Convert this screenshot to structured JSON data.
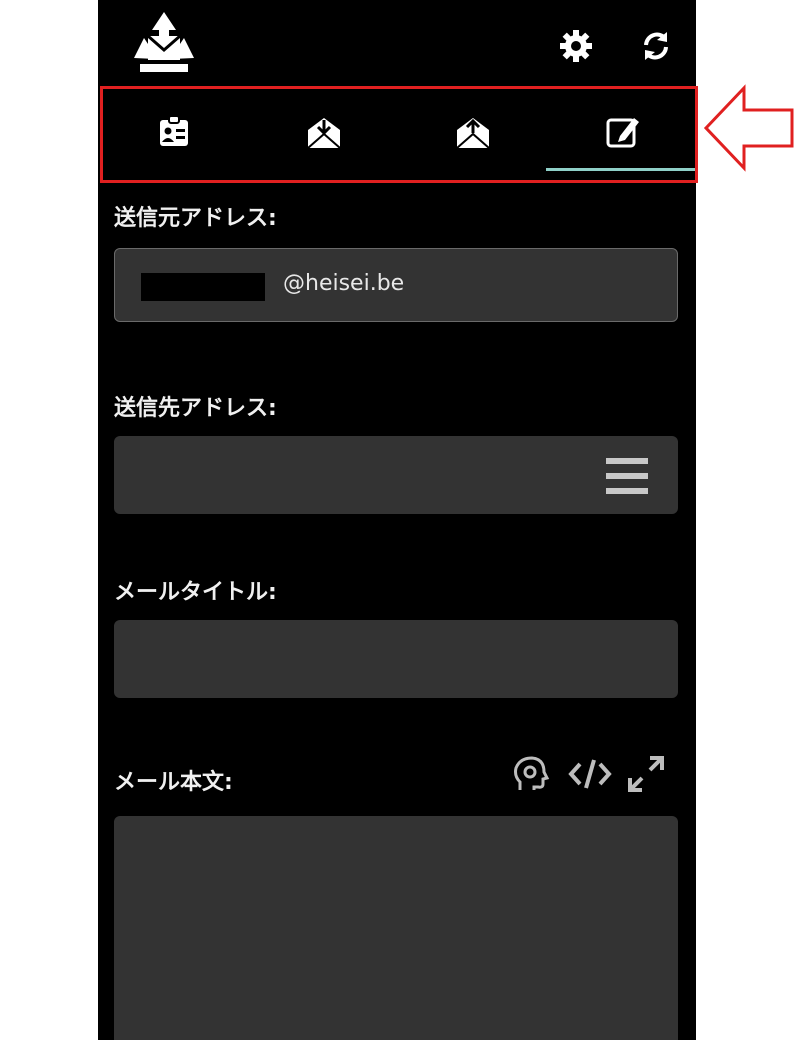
{
  "header": {
    "logo_icon": "recycle-mail-logo",
    "settings_icon": "gear-icon",
    "refresh_icon": "refresh-icon"
  },
  "tabs": [
    {
      "icon": "contact-card-icon",
      "active": false
    },
    {
      "icon": "mail-inbox-icon",
      "active": false
    },
    {
      "icon": "mail-send-icon",
      "active": false
    },
    {
      "icon": "compose-icon",
      "active": true
    }
  ],
  "form": {
    "from_label": "送信元アドレス:",
    "from_value": "@heisei.be",
    "to_label": "送信先アドレス:",
    "to_value": "",
    "subject_label": "メールタイトル:",
    "subject_value": "",
    "body_label": "メール本文:",
    "body_value": ""
  },
  "body_tools": [
    "ai-head-icon",
    "code-icon",
    "expand-icon"
  ],
  "colors": {
    "app_bg": "#000000",
    "field_bg": "#333333",
    "tab_indicator": "#8fd0c8",
    "annotation": "#e02020"
  }
}
